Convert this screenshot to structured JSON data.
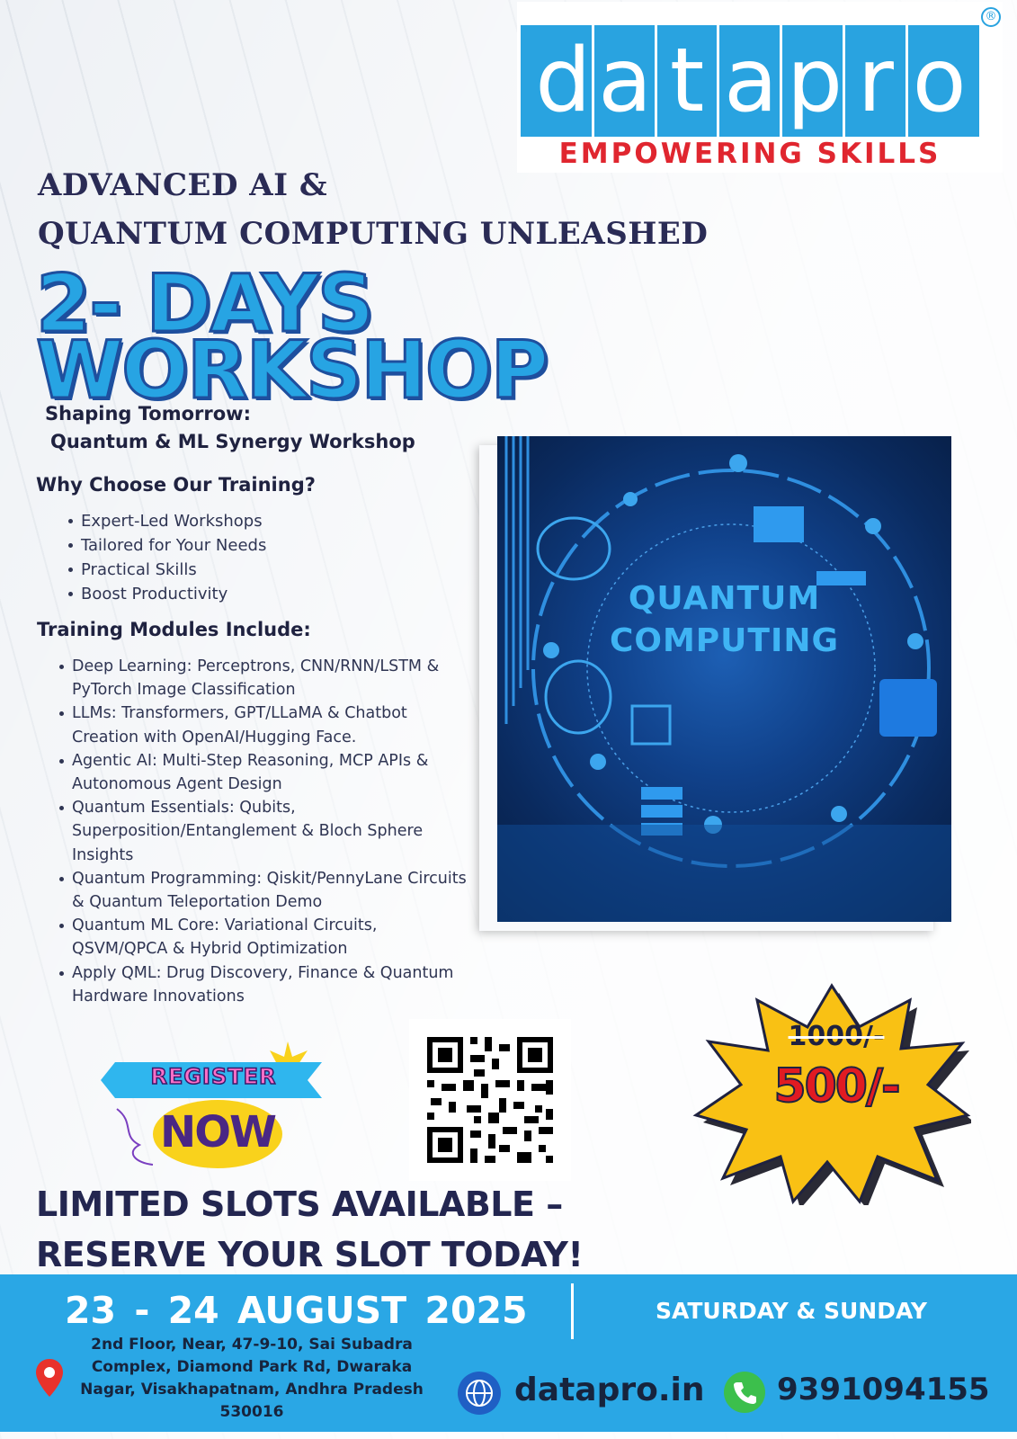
{
  "brand": {
    "logo_letters": [
      "d",
      "a",
      "t",
      "a",
      "p",
      "r",
      "o"
    ],
    "tagline": "EMPOWERING SKILLS",
    "registered_mark": "®",
    "colors": {
      "blue": "#29a3e0",
      "red": "#e0262f"
    }
  },
  "headline": {
    "line1": "ADVANCED AI &",
    "line2": "QUANTUM COMPUTING UNLEASHED",
    "big1": "2- DAYS",
    "big2": "WORKSHOP",
    "sub1": "Shaping Tomorrow:",
    "sub2": "Quantum & ML Synergy Workshop"
  },
  "why": {
    "heading": "Why Choose Our Training?",
    "items": [
      "Expert-Led Workshops",
      "Tailored for Your Needs",
      "Practical Skills",
      "Boost Productivity"
    ]
  },
  "modules": {
    "heading": "Training Modules Include:",
    "items": [
      [
        "Deep Learning: Perceptrons, CNN/RNN/LSTM &",
        "PyTorch Image Classification"
      ],
      [
        "LLMs: Transformers, GPT/LLaMA & Chatbot",
        "Creation with OpenAI/Hugging Face."
      ],
      [
        "Agentic AI: Multi-Step Reasoning, MCP APIs &",
        "Autonomous Agent Design"
      ],
      [
        "Quantum Essentials: Qubits,",
        "Superposition/Entanglement & Bloch Sphere",
        "Insights"
      ],
      [
        "Quantum Programming: Qiskit/PennyLane Circuits",
        "& Quantum Teleportation Demo"
      ],
      [
        "Quantum ML Core: Variational Circuits,",
        "QSVM/QPCA & Hybrid Optimization"
      ],
      [
        "Apply QML: Drug Discovery, Finance & Quantum",
        "Hardware Innovations"
      ]
    ]
  },
  "image": {
    "line1": "QUANTUM",
    "line2": "COMPUTING"
  },
  "price": {
    "old": "1000/-",
    "new": "500/-"
  },
  "register": {
    "top": "REGISTER",
    "bottom": "NOW"
  },
  "cta": {
    "line1": "LIMITED SLOTS AVAILABLE –",
    "line2": "RESERVE YOUR SLOT TODAY!"
  },
  "footer": {
    "date": "23 - 24 AUGUST 2025",
    "days": "SATURDAY & SUNDAY",
    "address": "2nd Floor, Near, 47-9-10, Sai Subadra Complex, Diamond Park Rd, Dwaraka Nagar, Visakhapatnam, Andhra Pradesh 530016",
    "website": "datapro.in",
    "phone": "9391094155"
  }
}
